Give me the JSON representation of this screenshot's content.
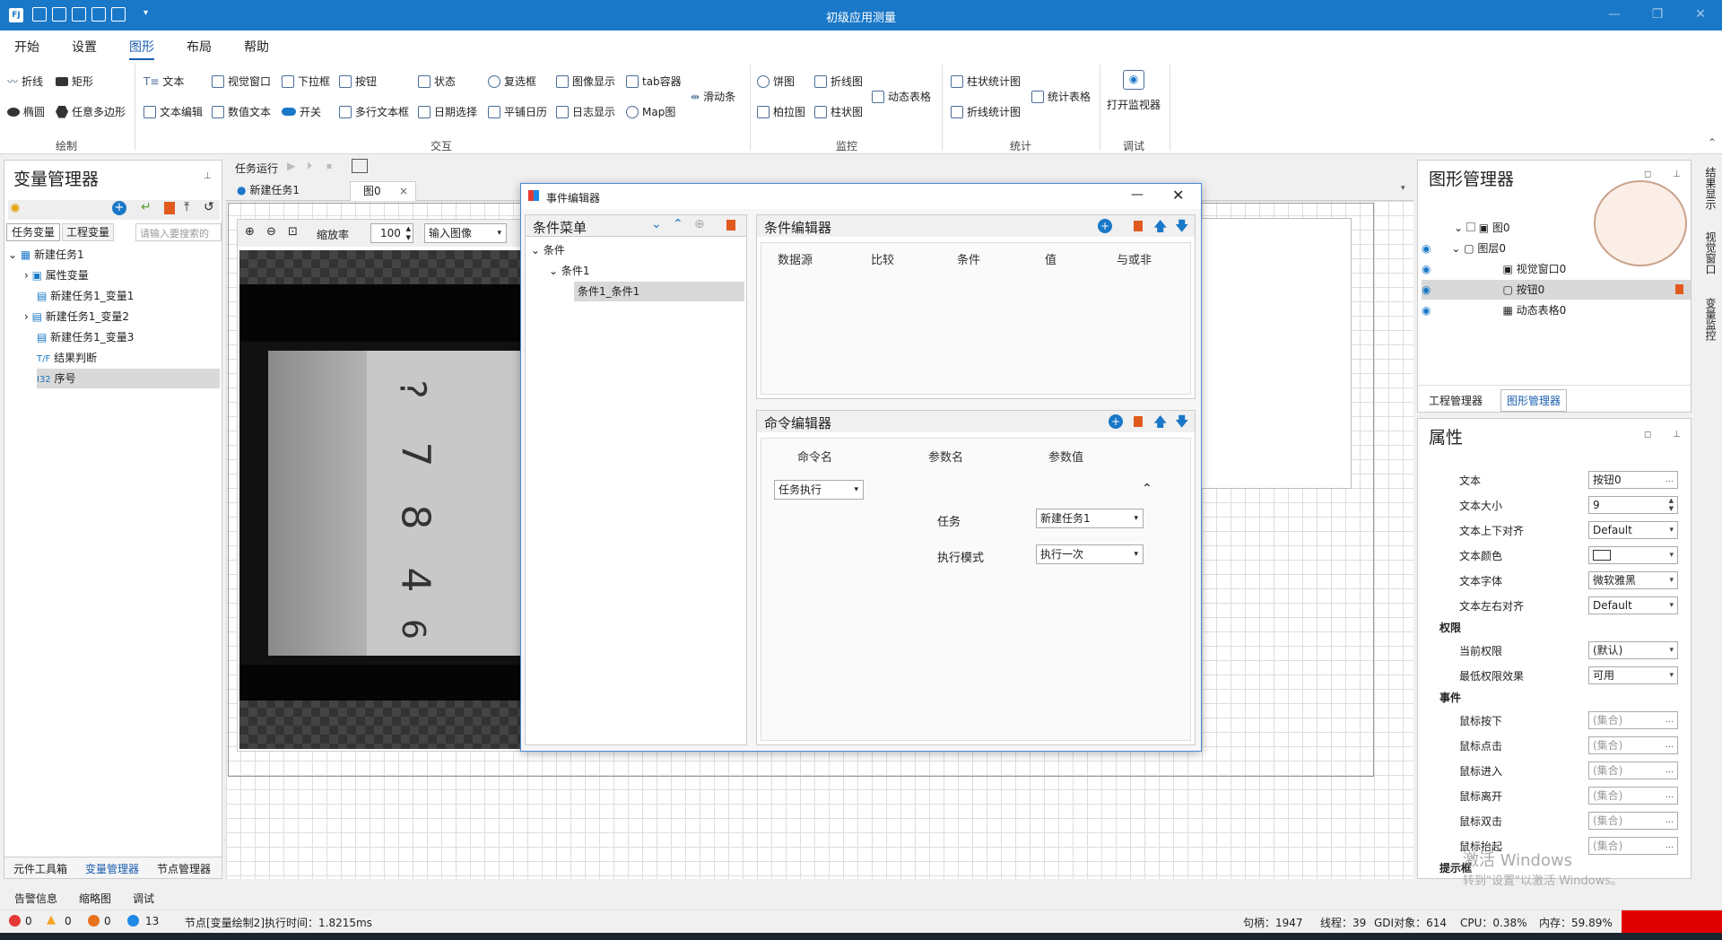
{
  "app": {
    "title": "初级应用测量"
  },
  "menu": [
    "开始",
    "设置",
    "图形",
    "布局",
    "帮助"
  ],
  "ribbon": {
    "draw": {
      "items": [
        "折线",
        "矩形",
        "椭圆",
        "任意多边形"
      ],
      "group": "绘制"
    },
    "interact": {
      "items": [
        "文本",
        "视觉窗口",
        "下拉框",
        "按钮",
        "状态",
        "复选框",
        "图像显示",
        "tab容器",
        "文本编辑",
        "数值文本",
        "开关",
        "多行文本框",
        "日期选择",
        "平铺日历",
        "日志显示",
        "Map图",
        "滑动条"
      ],
      "group": "交互"
    },
    "monitor": {
      "items": [
        "饼图",
        "折线图",
        "柏拉图",
        "柱状图",
        "动态表格"
      ],
      "group": "监控"
    },
    "stats": {
      "items": [
        "柱状统计图",
        "折线统计图",
        "统计表格"
      ],
      "group": "统计"
    },
    "debug": {
      "items": [
        "打开监视器"
      ],
      "group": "调试"
    }
  },
  "var_manager": {
    "title": "变量管理器",
    "tabs": [
      "任务变量",
      "工程变量"
    ],
    "search_placeholder": "请输入要搜索的",
    "tree": [
      "新建任务1",
      "属性变量",
      "新建任务1_变量1",
      "新建任务1_变量2",
      "新建任务1_变量3",
      "结果判断",
      "序号"
    ],
    "bottom_tabs": [
      "元件工具箱",
      "变量管理器",
      "节点管理器"
    ]
  },
  "task_toolbar": {
    "label": "任务运行"
  },
  "doc_tabs": [
    "新建任务1",
    "图0"
  ],
  "viewer": {
    "zoom_label": "缩放率",
    "zoom_value": "100",
    "image_select": "输入图像"
  },
  "event_editor": {
    "title": "事件编辑器",
    "cond_menu_title": "条件菜单",
    "cond_tree": [
      "条件",
      "条件1",
      "条件1_条件1"
    ],
    "cond_editor_title": "条件编辑器",
    "cond_cols": [
      "数据源",
      "比较",
      "条件",
      "值",
      "与或非"
    ],
    "cmd_editor_title": "命令编辑器",
    "cmd_cols": [
      "命令名",
      "参数名",
      "参数值"
    ],
    "cmd_combo": "任务执行",
    "task_label": "任务",
    "task_value": "新建任务1",
    "mode_label": "执行模式",
    "mode_value": "执行一次"
  },
  "shape_manager": {
    "title": "图形管理器",
    "tree": [
      "图0",
      "图层0",
      "视觉窗口0",
      "按钮0",
      "动态表格0"
    ],
    "tabs": [
      "工程管理器",
      "图形管理器"
    ],
    "side_tabs": [
      "结果显示",
      "视觉窗口",
      "变量监控"
    ]
  },
  "properties": {
    "title": "属性",
    "rows": [
      {
        "label": "文本",
        "value": "按钮0",
        "btn": "..."
      },
      {
        "label": "文本大小",
        "value": "9",
        "btn": "spin"
      },
      {
        "label": "文本上下对齐",
        "value": "Default",
        "btn": "dd"
      },
      {
        "label": "文本颜色",
        "value": "",
        "btn": "dd"
      },
      {
        "label": "文本字体",
        "value": "微软雅黑",
        "btn": "dd"
      },
      {
        "label": "文本左右对齐",
        "value": "Default",
        "btn": "dd"
      }
    ],
    "section_perm": "权限",
    "perm_rows": [
      {
        "label": "当前权限",
        "value": "(默认)",
        "btn": "dd"
      },
      {
        "label": "最低权限效果",
        "value": "可用",
        "btn": "dd"
      }
    ],
    "section_event": "事件",
    "event_rows": [
      {
        "label": "鼠标按下",
        "value": "(集合)"
      },
      {
        "label": "鼠标点击",
        "value": "(集合)"
      },
      {
        "label": "鼠标进入",
        "value": "(集合)"
      },
      {
        "label": "鼠标离开",
        "value": "(集合)"
      },
      {
        "label": "鼠标双击",
        "value": "(集合)"
      },
      {
        "label": "鼠标抬起",
        "value": "(集合)"
      }
    ],
    "section_tip": "提示框"
  },
  "watermark": {
    "line1": "激活 Windows",
    "line2": "转到\"设置\"以激活 Windows。"
  },
  "bottom_tabs": [
    "告警信息",
    "缩略图",
    "调试"
  ],
  "status": {
    "errors": "0",
    "warnings": "0",
    "orange": "0",
    "info": "13",
    "message": "节点[变量绘制2]执行时间：1.8215ms",
    "handles": "句柄：1947",
    "threads": "线程：39",
    "gdi": "GDI对象：614",
    "cpu": "CPU：0.38%",
    "mem": "内存：59.89%"
  },
  "colors": {
    "accent": "#1a78c8",
    "error": "#e53935",
    "warning": "#f5a623",
    "info": "#1e88e5"
  }
}
